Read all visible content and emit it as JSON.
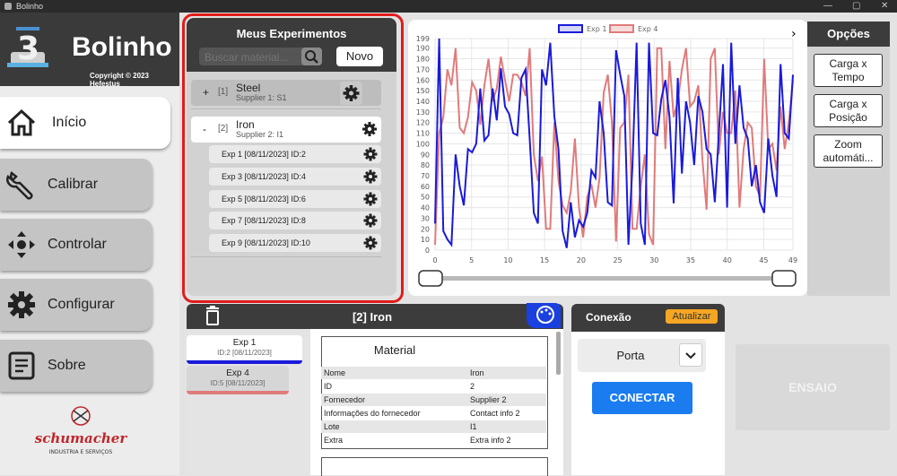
{
  "window": {
    "title": "Bolinho"
  },
  "brand": {
    "name": "Bolinho",
    "copyright": "Copyright © 2023 Hefestus"
  },
  "nav": [
    {
      "label": "Início",
      "icon": "home-icon",
      "active": true
    },
    {
      "label": "Calibrar",
      "icon": "wrench-icon"
    },
    {
      "label": "Controlar",
      "icon": "move-arrows-icon"
    },
    {
      "label": "Configurar",
      "icon": "gear-icon"
    },
    {
      "label": "Sobre",
      "icon": "document-icon"
    }
  ],
  "logo": {
    "name": "schumacher",
    "tagline": "INDUSTRIA E SERVIÇOS"
  },
  "experiments": {
    "title": "Meus Experimentos",
    "search_placeholder": "Buscar material...",
    "new_label": "Novo",
    "groups": [
      {
        "sign": "+",
        "num": "[1]",
        "name": "Steel",
        "sub": "Supplier 1: S1"
      },
      {
        "sign": "-",
        "num": "[2]",
        "name": "Iron",
        "sub": "Supplier 2: I1"
      }
    ],
    "items": [
      "Exp 1 [08/11/2023] ID:2",
      "Exp 3 [08/11/2023] ID:4",
      "Exp 5 [08/11/2023] ID:6",
      "Exp 7 [08/11/2023] ID:8",
      "Exp 9 [08/11/2023] ID:10"
    ]
  },
  "options": {
    "title": "Opções",
    "buttons": [
      {
        "line1": "Carga x",
        "line2": "Tempo"
      },
      {
        "line1": "Carga x",
        "line2": "Posição"
      },
      {
        "line1": "Zoom",
        "line2": "automáti..."
      }
    ]
  },
  "chart_data": {
    "type": "line",
    "title": "",
    "xlabel": "",
    "ylabel": "",
    "xlim": [
      0,
      49
    ],
    "ylim": [
      0,
      199
    ],
    "x_ticks": [
      0,
      5,
      10,
      15,
      20,
      25,
      30,
      35,
      40,
      45,
      49
    ],
    "y_ticks": [
      0,
      10,
      20,
      30,
      40,
      50,
      60,
      70,
      80,
      90,
      100,
      110,
      120,
      130,
      140,
      150,
      160,
      170,
      180,
      190,
      199
    ],
    "grid": true,
    "legend": "top-center",
    "series": [
      {
        "name": "Exp 1",
        "color": "#1a1adb",
        "values": [
          25,
          199,
          18,
          10,
          5,
          90,
          60,
          42,
          95,
          92,
          100,
          152,
          103,
          108,
          152,
          122,
          171,
          135,
          128,
          110,
          108,
          162,
          170,
          105,
          35,
          25,
          170,
          155,
          195,
          126,
          95,
          18,
          2,
          45,
          12,
          28,
          22,
          35,
          75,
          68,
          140,
          110,
          45,
          42,
          188,
          165,
          145,
          5,
          80,
          195,
          25,
          5,
          195,
          110,
          108,
          142,
          160,
          125,
          44,
          162,
          72,
          140,
          120,
          80,
          145,
          130,
          95,
          90,
          45,
          110,
          175,
          40,
          195,
          100,
          155,
          115,
          105,
          60,
          80,
          45,
          35,
          105,
          70,
          50,
          175,
          110,
          105,
          165
        ]
      },
      {
        "name": "Exp 4",
        "color": "#e07b7b",
        "values": [
          5,
          110,
          125,
          170,
          155,
          190,
          115,
          110,
          125,
          158,
          150,
          118,
          155,
          180,
          140,
          152,
          182,
          160,
          140,
          165,
          165,
          158,
          145,
          190,
          90,
          65,
          88,
          20,
          20,
          120,
          65,
          42,
          35,
          55,
          105,
          40,
          12,
          50,
          62,
          40,
          68,
          148,
          165,
          120,
          8,
          115,
          120,
          165,
          20,
          20,
          60,
          90,
          15,
          5,
          190,
          190,
          95,
          178,
          125,
          140,
          170,
          190,
          135,
          140,
          155,
          85,
          38,
          180,
          190,
          90,
          130,
          110,
          110,
          150,
          40,
          95,
          120,
          115,
          60,
          50,
          180,
          95,
          100,
          75,
          135,
          95,
          120,
          160
        ]
      }
    ]
  },
  "detail": {
    "title": "[2] Iron",
    "runs": [
      {
        "name": "Exp 1",
        "id": "ID:2 [08/11/2023]",
        "color": "#1a1adb"
      },
      {
        "name": "Exp 4",
        "id": "ID:5 [08/11/2023]",
        "color": "#e07b7b"
      }
    ],
    "material_title": "Material",
    "rows": [
      {
        "k": "Nome",
        "v": "Iron"
      },
      {
        "k": "ID",
        "v": "2"
      },
      {
        "k": "Fornecedor",
        "v": "Supplier 2"
      },
      {
        "k": "Informações do fornecedor",
        "v": "Contact info 2"
      },
      {
        "k": "Lote",
        "v": "I1"
      },
      {
        "k": "Extra",
        "v": "Extra info 2"
      }
    ]
  },
  "connection": {
    "title": "Conexão",
    "refresh_label": "Atualizar",
    "port_label": "Porta",
    "connect_label": "CONECTAR"
  },
  "ensaio_label": "ENSAIO"
}
